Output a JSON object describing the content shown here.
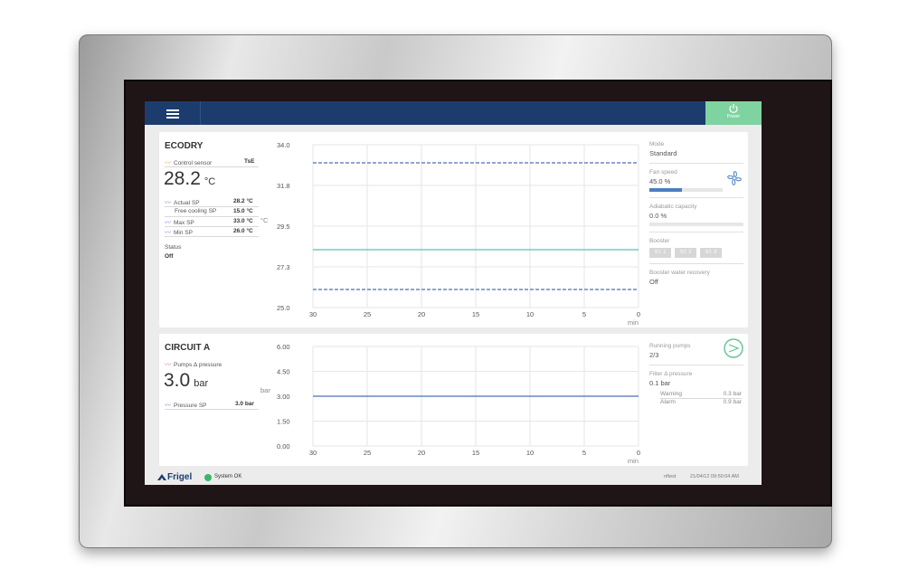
{
  "header": {
    "power_label": "Power"
  },
  "ecodry": {
    "title": "ECODRY",
    "control_sensor_label": "Control sensor",
    "control_sensor_value": "TsE",
    "temperature": "28.2",
    "temperature_unit": "°C",
    "rows": [
      {
        "label": "Actual SP",
        "value": "28.2 °C",
        "trend": true
      },
      {
        "label": "Free cooling SP",
        "value": "15.0 °C",
        "trend": false
      },
      {
        "label": "Max SP",
        "value": "33.0 °C",
        "trend": true
      },
      {
        "label": "Min SP",
        "value": "26.0 °C",
        "trend": true
      }
    ],
    "status_label": "Status",
    "status_value": "Off",
    "right": {
      "mode_label": "Mode",
      "mode_value": "Standard",
      "fan_speed_label": "Fan speed",
      "fan_speed_value": "45.0 %",
      "fan_speed_fraction": 0.45,
      "adiabatic_label": "Adiabatic capacity",
      "adiabatic_value": "0.0 %",
      "booster_label": "Booster",
      "booster_stages": [
        "ST. 1",
        "ST. 2",
        "ST. 3"
      ],
      "booster_water_label": "Booster water recovery",
      "booster_water_value": "Off"
    }
  },
  "circuit": {
    "title": "CIRCUIT A",
    "pressure_label": "Pumps Δ pressure",
    "pressure": "3.0",
    "pressure_unit": "bar",
    "sp_label": "Pressure SP",
    "sp_value": "3.0 bar",
    "right": {
      "running_pumps_label": "Running pumps",
      "running_pumps_value": "2/3",
      "filter_label": "Filter Δ pressure",
      "filter_value": "0.1 bar",
      "warning_label": "Warning",
      "warning_value": "0.3 bar",
      "alarm_label": "Alarm",
      "alarm_value": "0.9 bar"
    }
  },
  "chart_data": [
    {
      "type": "line",
      "ylabel": "°C",
      "xlabel": "min",
      "x_ticks": [
        "30",
        "25",
        "20",
        "15",
        "10",
        "5",
        "0"
      ],
      "y_ticks": [
        "34.0",
        "31.8",
        "29.5",
        "27.3",
        "25.0"
      ],
      "xlim": [
        30,
        0
      ],
      "ylim": [
        25.0,
        34.0
      ],
      "grid": true,
      "series": [
        {
          "x": [
            30,
            0
          ],
          "y": [
            33.0,
            33.0
          ],
          "color": "#4a6fb5",
          "dashed": true
        },
        {
          "x": [
            30,
            0
          ],
          "y": [
            28.2,
            28.2
          ],
          "color": "#5bc0b4",
          "dashed": false
        },
        {
          "x": [
            30,
            0
          ],
          "y": [
            26.0,
            26.0
          ],
          "color": "#4a6fb5",
          "dashed": true
        }
      ]
    },
    {
      "type": "line",
      "ylabel": "bar",
      "xlabel": "min",
      "x_ticks": [
        "30",
        "25",
        "20",
        "15",
        "10",
        "5",
        "0"
      ],
      "y_ticks": [
        "6.00",
        "4.50",
        "3.00",
        "1.50",
        "0.00"
      ],
      "xlim": [
        30,
        0
      ],
      "ylim": [
        0.0,
        6.0
      ],
      "grid": true,
      "series": [
        {
          "x": [
            30,
            0
          ],
          "y": [
            3.0,
            3.0
          ],
          "color": "#4a6fb5",
          "dashed": false
        }
      ]
    }
  ],
  "footer": {
    "logo_text": "Frigel",
    "status_text": "System OK",
    "user": "nftest",
    "datetime": "21/04/12 09:50:04 AM"
  }
}
